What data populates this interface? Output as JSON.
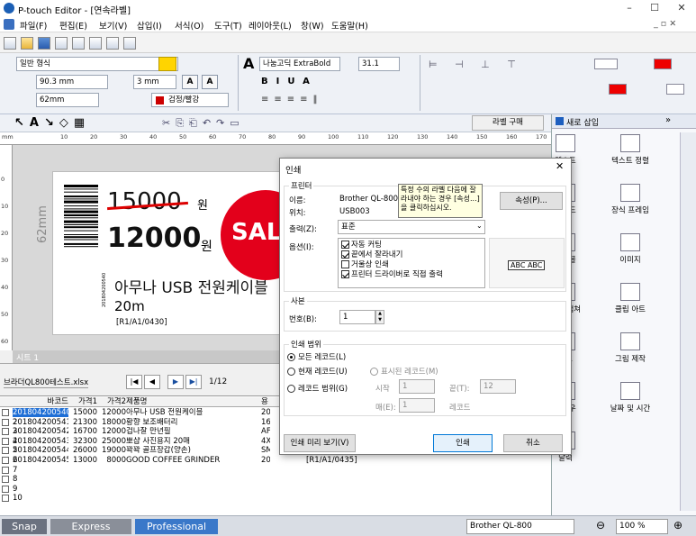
{
  "window": {
    "title": "P-touch Editor - [연속라벨]",
    "minimize": "–",
    "maximize": "☐",
    "close": "✕"
  },
  "menu": [
    "파일(F)",
    "편집(E)",
    "보기(V)",
    "삽입(I)",
    "서식(O)",
    "도구(T)",
    "레이아웃(L)",
    "창(W)",
    "도움말(H)"
  ],
  "menu_right": "_ ▫ ✕",
  "ribbon": {
    "media": "일반 형식",
    "width": "90.3 mm",
    "margin": "3 mm",
    "length": "62mm",
    "colors": "검정/빨강",
    "font": "나눔고딕 ExtraBold",
    "size": "31.1"
  },
  "toolbar3": {
    "buy_label": "라벨 구매"
  },
  "ruler_ticks": [
    "mm",
    "10",
    "20",
    "30",
    "40",
    "50",
    "60",
    "70",
    "80",
    "90",
    "100",
    "110",
    "120",
    "130",
    "140",
    "150",
    "160",
    "170"
  ],
  "vruler_ticks": [
    "0",
    "10",
    "20",
    "30",
    "40",
    "50",
    "60"
  ],
  "label": {
    "old_price": "15000",
    "won1": "원",
    "new_price": "12000",
    "won2": "원",
    "sale": "SAL",
    "product": "아무나 USB 전원케이블",
    "length": "20m",
    "location": "[R1/A1/0430]",
    "side_mm": "62mm",
    "barcode_text": "201804200540"
  },
  "sheet_tab": "시트 1",
  "db": {
    "file": "브라더QL800테스트.xlsx",
    "page": "1/12"
  },
  "grid": {
    "headers": [
      "바코드",
      "가격1",
      "가격2",
      "제품명",
      "용"
    ],
    "rows": [
      {
        "n": "1",
        "code": "201804200540",
        "p1": "15000",
        "p2": "12000",
        "name": "아무나 USB 전원케이블",
        "x": "20"
      },
      {
        "n": "2",
        "code": "201804200541",
        "p1": "21300",
        "p2": "18000",
        "name": "황향 보조배터리",
        "x": "16"
      },
      {
        "n": "3",
        "code": "201804200542",
        "p1": "16700",
        "p2": "12000",
        "name": "겁나잘 만년필",
        "x": "AF"
      },
      {
        "n": "4",
        "code": "201804200543",
        "p1": "32300",
        "p2": "25000",
        "name": "뽀샵 사진용지 20매",
        "x": "4X"
      },
      {
        "n": "5",
        "code": "201804200544",
        "p1": "26000",
        "p2": "19000",
        "name": "꽉꽉 골프장갑(양손)",
        "x": "SM"
      },
      {
        "n": "6",
        "code": "201804200545",
        "p1": "13000",
        "p2": "8000",
        "name": "GOOD COFFEE GRINDER",
        "x": "20ml",
        "loc": "[R1/A1/0435]"
      },
      {
        "n": "7"
      },
      {
        "n": "8"
      },
      {
        "n": "9"
      },
      {
        "n": "10"
      }
    ]
  },
  "rightpane": {
    "header": "새로 삽입",
    "items": [
      "텍스트",
      "텍스트 정렬",
      "바코드",
      "장식 프레임",
      "테이블",
      "이미지",
      "화면 캡쳐",
      "클립 아트",
      "기호",
      "그림 제작",
      "클라우",
      "날짜 및 시간",
      "달력"
    ]
  },
  "status": {
    "snap": "Snap",
    "express": "Express",
    "professional": "Professional",
    "printer": "Brother QL-800",
    "zoom": "100 %"
  },
  "dialog": {
    "title": "인쇄",
    "close": "✕",
    "printer_group": "프린터",
    "name_label": "이름:",
    "name_value": "Brother QL-800",
    "loc_label": "위치:",
    "loc_value": "USB003",
    "tooltip": "특정 수의 라벨 다음에 잘라내야 하는 경우 [속성...]을 클릭하십시오.",
    "props_button": "속성(P)...",
    "output_label": "출력(Z):",
    "output_value": "표준",
    "options_label": "옵션(I):",
    "options": [
      {
        "label": "자동 커팅",
        "on": true
      },
      {
        "label": "끝에서 잘라내기",
        "on": true
      },
      {
        "label": "거울상 인쇄",
        "on": false
      },
      {
        "label": "프린터 드라이버로 직접 출력",
        "on": true
      }
    ],
    "preview_text": "ABC ABC",
    "copies_group": "사본",
    "copies_label": "번호(B):",
    "copies_value": "1",
    "range_group": "인쇄 범위",
    "r_all": "모든 레코드(L)",
    "r_current": "현재 레코드(U)",
    "r_shown": "표시된 레코드(M)",
    "r_range": "레코드 범위(G)",
    "start_label": "시작",
    "start_value": "1",
    "end_label": "끝(T):",
    "end_value": "12",
    "count_label": "매(E):",
    "count_value": "1",
    "records": "레코드",
    "preview_button": "인쇄 미리 보기(V)",
    "print_button": "인쇄",
    "cancel_button": "취소"
  }
}
